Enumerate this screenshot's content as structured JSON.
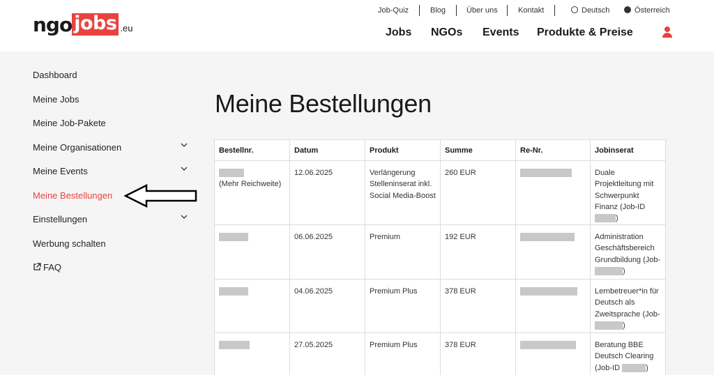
{
  "logo": {
    "part1": "ngo",
    "part2": "jobs",
    "part3": ".eu"
  },
  "topnav": {
    "items": [
      "Job-Quiz",
      "Blog",
      "Über uns",
      "Kontakt"
    ],
    "language": "Deutsch",
    "country": "Österreich"
  },
  "mainnav": [
    "Jobs",
    "NGOs",
    "Events",
    "Produkte & Preise"
  ],
  "sidebar": {
    "items": [
      {
        "label": "Dashboard"
      },
      {
        "label": "Meine Jobs"
      },
      {
        "label": "Meine Job-Pakete"
      },
      {
        "label": "Meine Organisationen"
      },
      {
        "label": "Meine Events"
      },
      {
        "label": "Meine Bestellungen"
      },
      {
        "label": "Einstellungen"
      },
      {
        "label": "Werbung schalten"
      },
      {
        "label": "FAQ"
      }
    ]
  },
  "page": {
    "title": "Meine Bestellungen"
  },
  "table": {
    "headers": [
      "Bestellnr.",
      "Datum",
      "Produkt",
      "Summe",
      "Re-Nr.",
      "Jobinserat"
    ],
    "rows": [
      {
        "note": "(Mehr Reichweite)",
        "date": "12.06.2025",
        "product": "Verlängerung Stelleninserat inkl. Social Media-Boost",
        "sum": "260 EUR",
        "job": "Duale Projektleitung mit Schwerpunkt Finanz (Job-ID",
        "job_end": ")"
      },
      {
        "note": "",
        "date": "06.06.2025",
        "product": "Premium",
        "sum": "192 EUR",
        "job": "Administration Geschäftsbereich Grundbildung (Job-",
        "job_end": ")"
      },
      {
        "note": "",
        "date": "04.06.2025",
        "product": "Premium Plus",
        "sum": "378 EUR",
        "job": "Lernbetreuer*in für Deutsch als Zweitsprache (Job-",
        "job_end": ")"
      },
      {
        "note": "",
        "date": "27.05.2025",
        "product": "Premium Plus",
        "sum": "378 EUR",
        "job": "Beratung BBE Deutsch Clearing (Job-ID",
        "job_end": ")"
      }
    ]
  },
  "colors": {
    "accent": "#e8433f",
    "background": "#f5f5f5",
    "text": "#1a1a1a"
  }
}
